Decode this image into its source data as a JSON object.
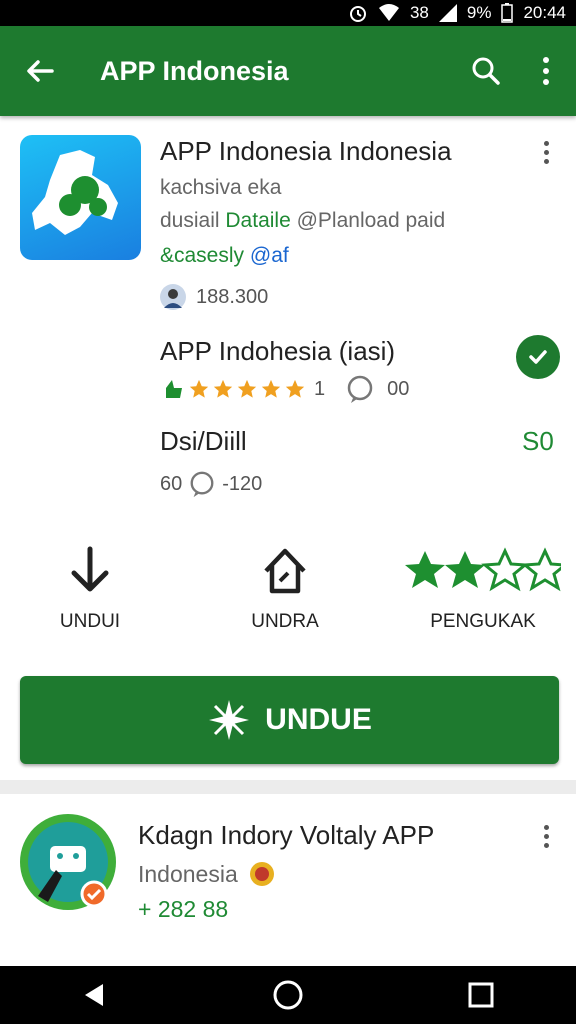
{
  "status": {
    "signal_text": "38",
    "battery": "9%",
    "time": "20:44"
  },
  "appbar": {
    "title": "APP Indonesia"
  },
  "app": {
    "name": "APP Indonesia Indonesia",
    "developer": "kachsiva eka",
    "line3_a": "dusiail",
    "line3_b": "Dataile",
    "line3_c": "@Planload paid",
    "line4_a": "&casesly",
    "line4_b": "@af",
    "downloads": "188.300",
    "installed_label": "APP Indohesia (iasi)",
    "rating_count": "1",
    "comment_count": "00",
    "detail_label": "Dsi/Diill",
    "price": "S0",
    "size_a": "60",
    "size_b": "-120"
  },
  "actions": [
    {
      "label": "UNDUI"
    },
    {
      "label": "UNDRA"
    },
    {
      "label": "PENGUKAK"
    }
  ],
  "install_button": {
    "label": "UNDUE"
  },
  "related": {
    "name": "Kdagn Indory Voltaly APP",
    "region": "Indonesia",
    "count": "+ 282 88"
  },
  "colors": {
    "primary": "#1e7a2f",
    "accent_blue": "#1a66d0",
    "star": "#f0a020"
  }
}
